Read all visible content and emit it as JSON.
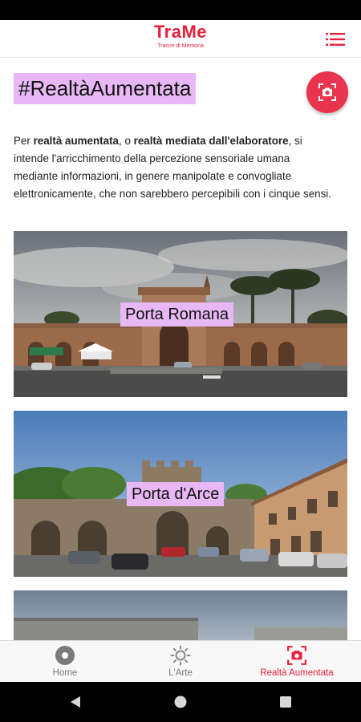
{
  "app": {
    "title": "TraMe",
    "subtitle": "Tracce di Memoria",
    "accent_color": "#e8203b",
    "highlight_color": "#e7b8f4"
  },
  "header": {
    "menu_icon": "hamburger-menu-icon"
  },
  "page": {
    "title": "#RealtàAumentata",
    "ar_button_icon": "ar-camera-icon",
    "intro": {
      "part1": "Per ",
      "bold1": "realtà aumentata",
      "part2": ", o ",
      "bold2": "realtà mediata dall'elaboratore",
      "part3": ", si intende l'arricchimento della percezione sensoriale umana mediante informazioni, in genere manipolate e convogliate elettronicamente, che non sarebbero percepibili con i cinque sensi."
    }
  },
  "cards": [
    {
      "label": "Porta Romana"
    },
    {
      "label": "Porta d'Arce"
    }
  ],
  "bottom_nav": {
    "items": [
      {
        "label": "Home",
        "icon": "home-circle-icon",
        "active": false
      },
      {
        "label": "L'Arte",
        "icon": "sun-icon",
        "active": false
      },
      {
        "label": "Realtà Aumentata",
        "icon": "ar-camera-icon",
        "active": true
      }
    ]
  },
  "system_nav": {
    "back_icon": "back-triangle-icon",
    "home_icon": "home-dot-icon",
    "recents_icon": "recents-square-icon"
  }
}
